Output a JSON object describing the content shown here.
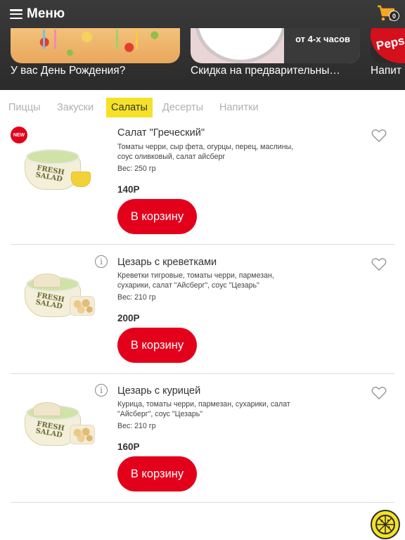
{
  "header": {
    "menu_label": "Меню",
    "cart_count": "0"
  },
  "promos": [
    {
      "caption": "У вас День Рождения?",
      "image": "birthday-pizza"
    },
    {
      "caption": "Скидка на предварительны…",
      "image": "clock",
      "overlay_text": "от 4-х часов"
    },
    {
      "caption": "Напит",
      "image": "pepsi",
      "overlay_text": "Peps"
    }
  ],
  "tabs": [
    {
      "label": "Пиццы",
      "active": false
    },
    {
      "label": "Закуски",
      "active": false
    },
    {
      "label": "Салаты",
      "active": true
    },
    {
      "label": "Десерты",
      "active": false
    },
    {
      "label": "Напитки",
      "active": false
    }
  ],
  "products": [
    {
      "badge": "NEW",
      "title": "Салат \"Греческий\"",
      "description": "Томаты черри, сыр фета, огурцы, перец, маслины, соус оливковый, салат айсберг",
      "weight": "Вес: 250 гр",
      "price": "140Р",
      "button": "В корзину",
      "image_label": "FRESH SALAD"
    },
    {
      "info": "i",
      "title": "Цезарь с креветками",
      "description": "Креветки тигровые, томаты черри, пармезан, сухарики, салат \"Айсберг\", соус \"Цезарь\"",
      "weight": "Вес: 210 гр",
      "price": "200Р",
      "button": "В корзину",
      "image_label": "FRESH SALAD"
    },
    {
      "info": "i",
      "title": "Цезарь с курицей",
      "description": "Курица, томаты черри, пармезан, сухарики, салат \"Айсберг\", соус \"Цезарь\"",
      "weight": "Вес: 210 гр",
      "price": "160Р",
      "button": "В корзину",
      "image_label": "FRESH SALAD"
    }
  ],
  "colors": {
    "header_bg": "#2b2b2b",
    "accent_yellow": "#f5e126",
    "button_red": "#e3001b",
    "cart_orange": "#f5a623"
  },
  "icons": {
    "menu": "hamburger-icon",
    "cart": "cart-icon",
    "favorite": "heart-outline-icon",
    "info": "info-icon",
    "fab": "pizza-icon"
  }
}
